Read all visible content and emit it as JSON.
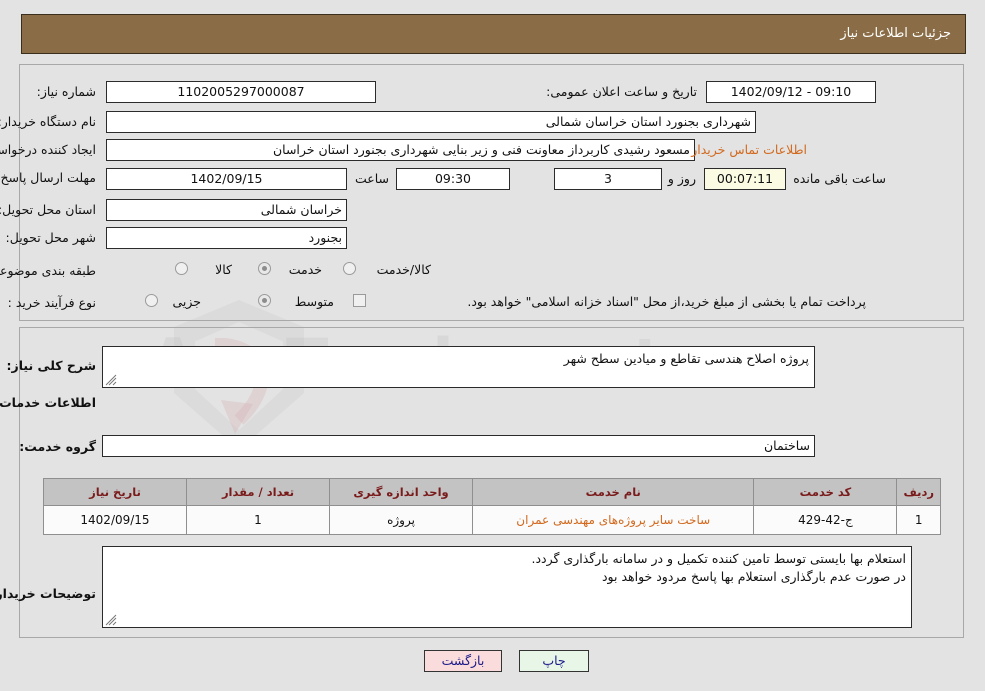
{
  "header": {
    "title": "جزئیات اطلاعات نیاز"
  },
  "fields": {
    "need_number_label": "شماره نیاز:",
    "need_number_value": "1102005297000087",
    "announce_label": "تاریخ و ساعت اعلان عمومی:",
    "announce_value": "09:10 - 1402/09/12",
    "buyer_org_label": "نام دستگاه خریدار:",
    "buyer_org_value": "شهرداری بجنورد استان خراسان شمالی",
    "requester_label": "ایجاد کننده درخواست:",
    "requester_value": "مسعود رشیدی کاربرداز معاونت فنی و زیر بنایی شهرداری بجنورد استان خراسان",
    "contact_link": "اطلاعات تماس خریدار",
    "deadline_label": "مهلت ارسال پاسخ: تا تاریخ:",
    "deadline_date": "1402/09/15",
    "deadline_time_label": "ساعت",
    "deadline_time": "09:30",
    "remaining_days": "3",
    "remaining_days_label": "روز و",
    "remaining_clock": "00:07:11",
    "remaining_suffix": "ساعت باقی مانده",
    "province_label": "استان محل تحویل:",
    "province_value": "خراسان شمالی",
    "city_label": "شهر محل تحویل:",
    "city_value": "بجنورد",
    "category_label": "طبقه بندی موضوعی:",
    "category_options": [
      "کالا",
      "خدمت",
      "کالا/خدمت"
    ],
    "category_selected": "خدمت",
    "process_label": "نوع فرآیند خرید :",
    "process_options": [
      "جزیی",
      "متوسط"
    ],
    "process_selected": "متوسط",
    "treasury_note": "پرداخت تمام یا بخشی از مبلغ خرید،از محل \"اسناد خزانه اسلامی\" خواهد بود.",
    "treasury_checked": false
  },
  "description": {
    "label": "شرح کلی نیاز:",
    "value": "پروژه اصلاح هندسی تقاطع و میادین سطح شهر"
  },
  "services_section": {
    "heading": "اطلاعات خدمات مورد نیاز",
    "group_label": "گروه خدمت:",
    "group_value": "ساختمان"
  },
  "table": {
    "headers": [
      "ردیف",
      "کد خدمت",
      "نام خدمت",
      "واحد اندازه گیری",
      "تعداد / مقدار",
      "تاریخ نیاز"
    ],
    "rows": [
      {
        "row": "1",
        "code": "ج-42-429",
        "name": "ساخت سایر پروژه‌های مهندسی عمران",
        "unit": "پروژه",
        "quantity": "1",
        "date": "1402/09/15"
      }
    ]
  },
  "buyer_notes": {
    "label": "توضیحات خریدار:",
    "line1": "استعلام بها بایستی توسط تامین کننده تکمیل و در سامانه بارگذاری گردد.",
    "line2": "در صورت عدم بارگذاری استعلام بها پاسخ مردود خواهد بود"
  },
  "buttons": {
    "print": "چاپ",
    "back": "بازگشت"
  },
  "watermark": {
    "text": "AnaTender.net"
  },
  "colors": {
    "header_bar": "#8a6d46",
    "link": "#d2691e",
    "page_bg": "#e3e3e3",
    "table_header": "#c3c3c3",
    "print_btn": "#e8f6e8",
    "back_btn": "#fadcdc"
  }
}
